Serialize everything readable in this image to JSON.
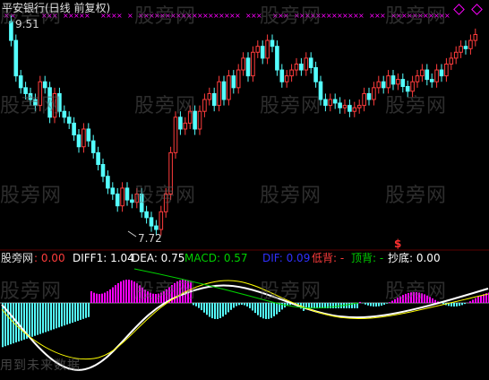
{
  "title": "平安银行(日线 前复权)",
  "price_high_label": "9.51",
  "price_low_label": "7.72",
  "indicator_bar": {
    "name": "股旁网",
    "name_value": ": 0.00",
    "diff": "DIFF1: 1.04",
    "dea": "DEA: 0.75",
    "macd": "MACD: 0.57",
    "dif": "DIF: 0.09",
    "low_div": "低背: -",
    "top_div": "顶背: -",
    "bottom": "抄底: 0.00"
  },
  "signal_glyph": "$",
  "watermark": "股旁网",
  "footer_watermark": "用到未来数据",
  "colors": {
    "up": "#ff3c3c",
    "down": "#54ffff",
    "markers": "#ff00ff",
    "diff_line": "#ffffff",
    "dea_line": "#ffff00",
    "green": "#00d000",
    "blue": "#3030ff"
  },
  "icons": {
    "corner": "diamond-icon"
  }
}
